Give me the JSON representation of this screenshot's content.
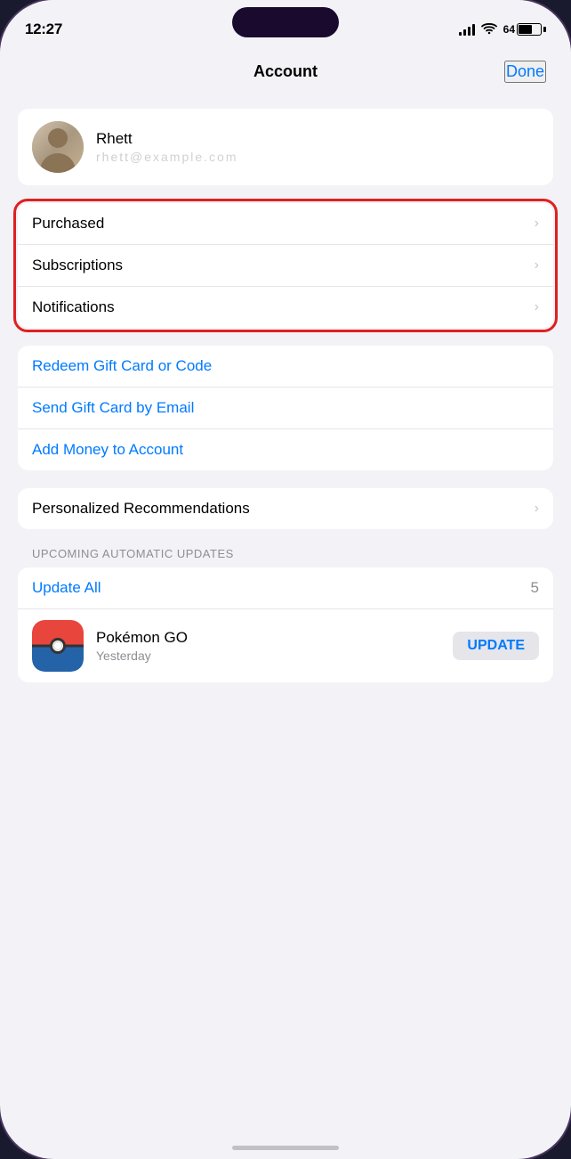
{
  "statusBar": {
    "time": "12:27",
    "battery": "64"
  },
  "header": {
    "title": "Account",
    "done": "Done"
  },
  "profile": {
    "name": "Rhett",
    "emailMasked": "••••••••@•••••••"
  },
  "menuGroups": [
    {
      "id": "account-nav",
      "items": [
        {
          "label": "Purchased",
          "hasChevron": true,
          "highlighted": true
        },
        {
          "label": "Subscriptions",
          "hasChevron": true,
          "highlighted": false
        },
        {
          "label": "Notifications",
          "hasChevron": true,
          "highlighted": false
        }
      ]
    },
    {
      "id": "gift-actions",
      "items": [
        {
          "label": "Redeem Gift Card or Code",
          "hasChevron": false,
          "blue": true
        },
        {
          "label": "Send Gift Card by Email",
          "hasChevron": false,
          "blue": true
        },
        {
          "label": "Add Money to Account",
          "hasChevron": false,
          "blue": true
        }
      ]
    },
    {
      "id": "recommendations",
      "items": [
        {
          "label": "Personalized Recommendations",
          "hasChevron": true,
          "highlighted": false
        }
      ]
    }
  ],
  "upcomingUpdates": {
    "sectionLabel": "UPCOMING AUTOMATIC UPDATES",
    "updateAllLabel": "Update All",
    "updateCount": "5",
    "apps": [
      {
        "name": "Pokémon GO",
        "subtitle": "Yesterday",
        "updateLabel": "UPDATE"
      }
    ]
  }
}
